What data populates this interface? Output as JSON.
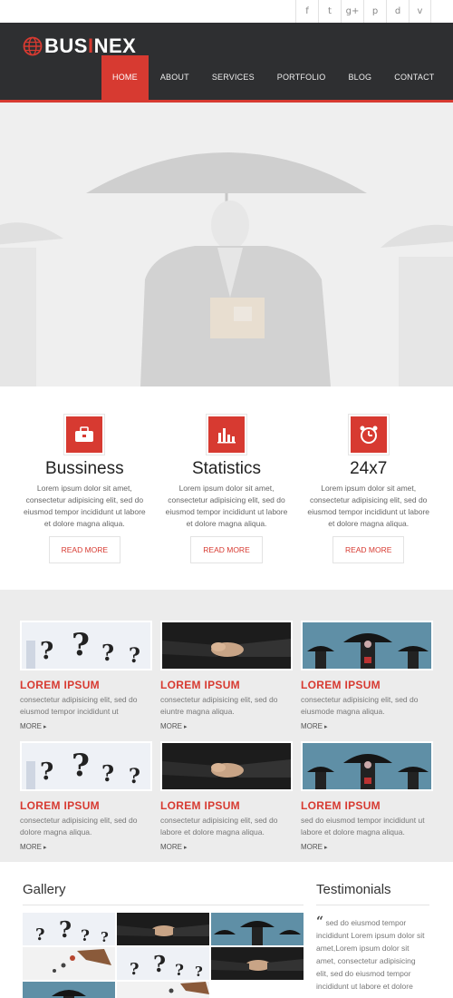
{
  "social": [
    "f",
    "t",
    "g+",
    "p",
    "d",
    "v"
  ],
  "social_icons": [
    "facebook-icon",
    "twitter-icon",
    "google-plus-icon",
    "pinterest-icon",
    "dribbble-icon",
    "vimeo-icon"
  ],
  "brand": {
    "prefix": "BUS",
    "highlight": "I",
    "suffix": "NEX"
  },
  "nav": [
    "HOME",
    "ABOUT",
    "SERVICES",
    "PORTFOLIO",
    "BLOG",
    "CONTACT"
  ],
  "features": [
    {
      "title": "Bussiness",
      "text": "Lorem ipsum dolor sit amet, consectetur adipisicing elit, sed do eiusmod tempor incididunt ut labore et dolore magna aliqua.",
      "button": "READ MORE",
      "icon": "briefcase-icon"
    },
    {
      "title": "Statistics",
      "text": "Lorem ipsum dolor sit amet, consectetur adipisicing elit, sed do eiusmod tempor incididunt ut labore et dolore magna aliqua.",
      "button": "READ MORE",
      "icon": "bar-chart-icon"
    },
    {
      "title": "24x7",
      "text": "Lorem ipsum dolor sit amet, consectetur adipisicing elit, sed do eiusmod tempor incididunt ut labore et dolore magna aliqua.",
      "button": "READ MORE",
      "icon": "alarm-clock-icon"
    }
  ],
  "portfolio": [
    {
      "title": "LOREM IPSUM",
      "text": "consectetur adipisicing elit, sed do eiusmod tempor incididunt ut",
      "more": "MORE"
    },
    {
      "title": "LOREM IPSUM",
      "text": "consectetur adipisicing elit, sed do eiuntre magna aliqua.",
      "more": "MORE"
    },
    {
      "title": "LOREM IPSUM",
      "text": "consectetur adipisicing elit, sed do eiusmode magna aliqua.",
      "more": "MORE"
    },
    {
      "title": "LOREM IPSUM",
      "text": "consectetur adipisicing elit, sed do dolore magna aliqua.",
      "more": "MORE"
    },
    {
      "title": "LOREM IPSUM",
      "text": "consectetur adipisicing elit, sed do labore et dolore magna aliqua.",
      "more": "MORE"
    },
    {
      "title": "LOREM IPSUM",
      "text": "sed do eiusmod tempor incididunt ut labore et dolore magna aliqua.",
      "more": "MORE"
    }
  ],
  "gallery": {
    "title": "Gallery"
  },
  "testimonials": {
    "title": "Testimonials",
    "quote": "sed do eiusmod tempor incididunt Lorem ipsum dolor sit amet,Lorem ipsum dolor sit amet, consectetur adipisicing elit, sed do eiusmod tempor incididunt ut labore et dolore"
  },
  "colors": {
    "accent": "#d73a31",
    "header": "#2e2f31",
    "portfolio_bg": "#ececec"
  }
}
